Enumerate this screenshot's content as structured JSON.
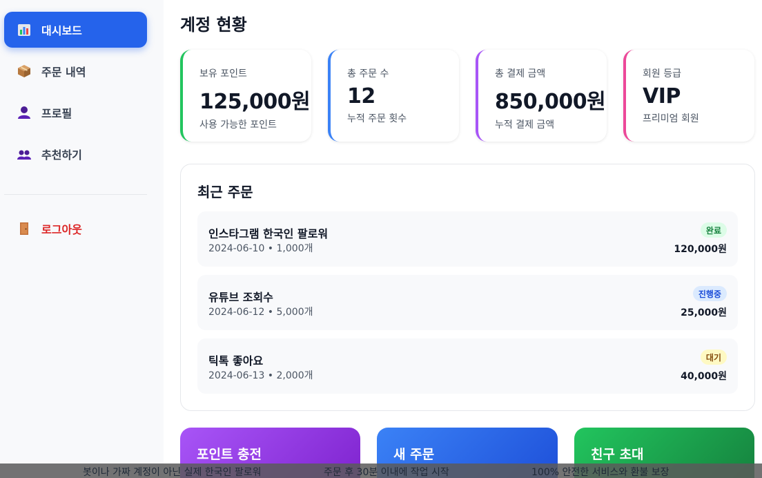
{
  "sidebar": {
    "items": [
      {
        "label": "대시보드",
        "icon": "bar-chart-icon"
      },
      {
        "label": "주문 내역",
        "icon": "package-icon"
      },
      {
        "label": "프로필",
        "icon": "user-icon"
      },
      {
        "label": "추천하기",
        "icon": "users-icon"
      }
    ],
    "logout": {
      "label": "로그아웃",
      "icon": "door-icon"
    }
  },
  "main": {
    "title": "계정 현황",
    "stats": [
      {
        "label": "보유 포인트",
        "value": "125,000원",
        "sub": "사용 가능한 포인트",
        "color": "#22c55e"
      },
      {
        "label": "총 주문 수",
        "value": "12",
        "sub": "누적 주문 횟수",
        "color": "#3b82f6"
      },
      {
        "label": "총 결제 금액",
        "value": "850,000원",
        "sub": "누적 결제 금액",
        "color": "#a855f7"
      },
      {
        "label": "회원 등급",
        "value": "VIP",
        "sub": "프리미엄 회원",
        "color": "#ec4899"
      }
    ],
    "recent_orders": {
      "title": "최근 주문",
      "rows": [
        {
          "name": "인스타그램 한국인 팔로워",
          "meta": "2024-06-10 • 1,000개",
          "status": "완료",
          "price": "120,000원"
        },
        {
          "name": "유튜브 조회수",
          "meta": "2024-06-12 • 5,000개",
          "status": "진행중",
          "price": "25,000원"
        },
        {
          "name": "틱톡 좋아요",
          "meta": "2024-06-13 • 2,000개",
          "status": "대기",
          "price": "40,000원"
        }
      ]
    },
    "actions": [
      {
        "label": "포인트 충전"
      },
      {
        "label": "새 주문"
      },
      {
        "label": "친구 초대"
      }
    ]
  },
  "footer": {
    "items": [
      "봇이나 가짜 계정이 아닌 실제 한국인 팔로워",
      "주문 후 30분 이내에 작업 시작",
      "100% 안전한 서비스와 환불 보장"
    ]
  },
  "colors": {
    "primary": "#2563eb",
    "logout": "#dc2626",
    "status_done": "#dcfce7",
    "status_progress": "#dbeafe",
    "status_wait": "#fef9c3"
  }
}
